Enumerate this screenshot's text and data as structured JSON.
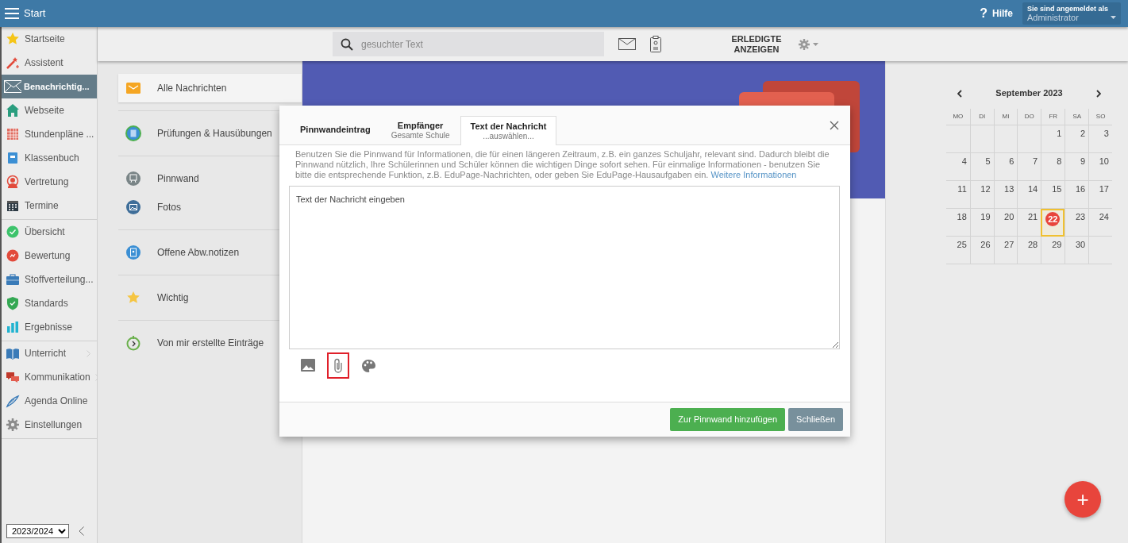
{
  "topbar": {
    "title": "Start",
    "help": {
      "icon_text": "?",
      "label": "Hilfe"
    },
    "user": {
      "caption": "Sie sind angemeldet als",
      "name": "Administrator"
    }
  },
  "sidebar": {
    "groups": [
      {
        "items": [
          {
            "label": "Startseite",
            "selected": false,
            "submenu": false
          },
          {
            "label": "Assistent",
            "selected": false,
            "submenu": false
          },
          {
            "label": "Benachrichtig...",
            "selected": true,
            "submenu": false
          },
          {
            "label": "Webseite",
            "selected": false,
            "submenu": false
          },
          {
            "label": "Stundenpläne ...",
            "selected": false,
            "submenu": false
          },
          {
            "label": "Klassenbuch",
            "selected": false,
            "submenu": false
          },
          {
            "label": "Vertretung",
            "selected": false,
            "submenu": false
          },
          {
            "label": "Termine",
            "selected": false,
            "submenu": false
          }
        ]
      },
      {
        "items": [
          {
            "label": "Übersicht",
            "selected": false,
            "submenu": false
          },
          {
            "label": "Bewertung",
            "selected": false,
            "submenu": false
          },
          {
            "label": "Stoffverteilung...",
            "selected": false,
            "submenu": false
          },
          {
            "label": "Standards",
            "selected": false,
            "submenu": false
          },
          {
            "label": "Ergebnisse",
            "selected": false,
            "submenu": false
          }
        ]
      },
      {
        "items": [
          {
            "label": "Unterricht",
            "selected": false,
            "submenu": true
          },
          {
            "label": "Kommunikation",
            "selected": false,
            "submenu": true
          },
          {
            "label": "Agenda Online",
            "selected": false,
            "submenu": false
          },
          {
            "label": "Einstellungen",
            "selected": false,
            "submenu": false
          }
        ]
      }
    ],
    "year_select": "2023/2024"
  },
  "toolbar": {
    "search": {
      "placeholder": "gesuchter Text"
    },
    "show_done": "ERLEDIGTE ANZEIGEN"
  },
  "folders": [
    {
      "items": [
        {
          "label": "Alle Nachrichten",
          "selected": true
        }
      ]
    },
    {
      "items": [
        {
          "label": "Prüfungen & Hausübungen",
          "selected": false
        }
      ]
    },
    {
      "items": [
        {
          "label": "Pinnwand",
          "selected": false
        },
        {
          "label": "Fotos",
          "selected": false
        }
      ]
    },
    {
      "items": [
        {
          "label": "Offene Abw.notizen",
          "selected": false
        }
      ]
    },
    {
      "items": [
        {
          "label": "Wichtig",
          "selected": false
        }
      ]
    },
    {
      "items": [
        {
          "label": "Von mir erstellte Einträge",
          "selected": false
        }
      ]
    }
  ],
  "dialog": {
    "tabs": [
      {
        "title": "Pinnwandeintrag",
        "selected": false
      },
      {
        "title": "Empfänger",
        "subtitle": "Gesamte Schule",
        "selected": false
      },
      {
        "title": "Text der Nachricht",
        "subtitle": "...auswählen...",
        "selected": true
      }
    ],
    "info": "Benutzen Sie die Pinnwand für Informationen, die für einen längeren Zeitraum, z.B. ein ganzes Schuljahr, relevant sind. Dadurch bleibt die Pinnwand nützlich, Ihre Schülerinnen und Schüler können die wichtigen Dinge sofort sehen. Für einmalige Informationen - benutzen Sie bitte die entsprechende Funktion, z.B. EduPage-Nachrichten, oder geben Sie EduPage-Hausaufgaben ein.",
    "info_link": "Weitere Informationen",
    "message": {
      "placeholder": "Text der Nachricht eingeben"
    },
    "tools": [
      {
        "kind": "image",
        "highlighted": false
      },
      {
        "kind": "attach",
        "highlighted": true
      },
      {
        "kind": "palette",
        "highlighted": false
      }
    ],
    "buttons": [
      {
        "label": "Zur Pinnwand hinzufügen",
        "kind": "primary"
      },
      {
        "label": "Schließen",
        "kind": "secondary"
      }
    ]
  },
  "calendar": {
    "title": "September 2023",
    "weekdays": [
      "MO",
      "DI",
      "MI",
      "DO",
      "FR",
      "SA",
      "SO"
    ],
    "weeks": [
      [
        {
          "day": "1",
          "today": false
        },
        {
          "day": "2",
          "today": false
        },
        {
          "day": "3",
          "today": false
        }
      ],
      [
        {
          "day": "4",
          "today": false
        },
        {
          "day": "5",
          "today": false
        },
        {
          "day": "6",
          "today": false
        },
        {
          "day": "7",
          "today": false
        },
        {
          "day": "8",
          "today": false
        },
        {
          "day": "9",
          "today": false
        },
        {
          "day": "10",
          "today": false
        }
      ],
      [
        {
          "day": "11",
          "today": false
        },
        {
          "day": "12",
          "today": false
        },
        {
          "day": "13",
          "today": false
        },
        {
          "day": "14",
          "today": false
        },
        {
          "day": "15",
          "today": false
        },
        {
          "day": "16",
          "today": false
        },
        {
          "day": "17",
          "today": false
        }
      ],
      [
        {
          "day": "18",
          "today": false
        },
        {
          "day": "19",
          "today": false
        },
        {
          "day": "20",
          "today": false
        },
        {
          "day": "21",
          "today": false
        },
        {
          "day": "22",
          "today": true
        },
        {
          "day": "23",
          "today": false
        },
        {
          "day": "24",
          "today": false
        }
      ],
      [
        {
          "day": "25",
          "today": false
        },
        {
          "day": "26",
          "today": false
        },
        {
          "day": "27",
          "today": false
        },
        {
          "day": "28",
          "today": false
        },
        {
          "day": "29",
          "today": false
        },
        {
          "day": "30",
          "today": false
        }
      ]
    ]
  },
  "fab": {
    "label": "+"
  }
}
